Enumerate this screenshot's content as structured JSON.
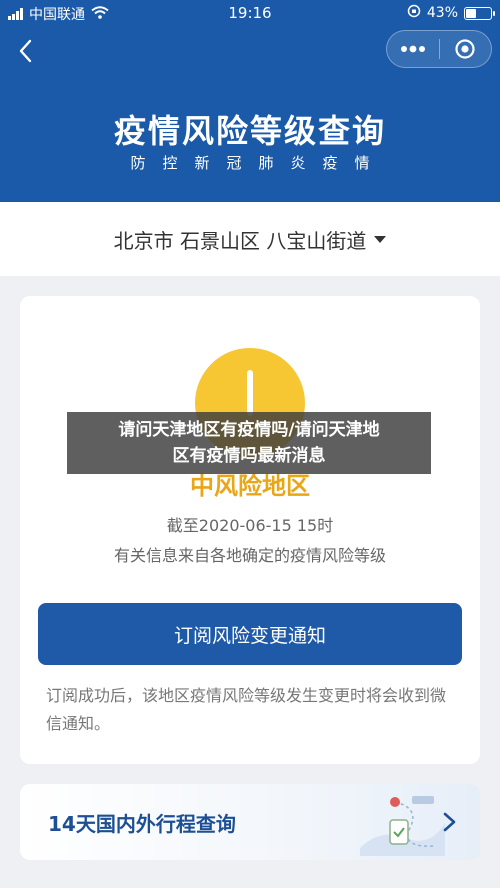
{
  "status_bar": {
    "carrier": "中国联通",
    "time": "19:16",
    "battery": "43%",
    "battery_level": 0.43
  },
  "header": {
    "title": "疫情风险等级查询",
    "subtitle": "防控新冠肺炎疫情",
    "back_icon": "chevron-left-icon",
    "more_icon": "more-dots-icon",
    "close_icon": "target-close-icon"
  },
  "location": {
    "text": "北京市 石景山区 八宝山街道"
  },
  "risk_card": {
    "level": "中风险地区",
    "deadline": "截至2020-06-15 15时",
    "source": "有关信息来自各地确定的疫情风险等级",
    "subscribe_button": "订阅风险变更通知",
    "tip": "订阅成功后，该地区疫情风险等级发生变更时将会收到微信通知。",
    "color": "#f6c633"
  },
  "travel_card": {
    "label": "14天国内外行程查询"
  },
  "overlay_caption": {
    "line1": "请问天津地区有疫情吗/请问天津地",
    "line2": "区有疫情吗最新消息"
  },
  "colors": {
    "header_bg": "#1a5aa8",
    "button_bg": "#1f5aa8",
    "risk_text": "#e9a617"
  }
}
